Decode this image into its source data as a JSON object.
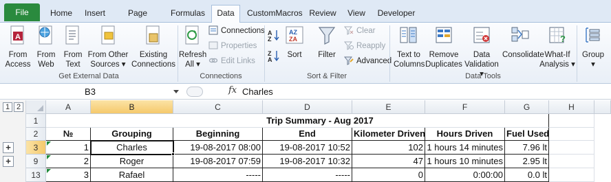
{
  "ribbon_tabs": [
    {
      "label": "File"
    },
    {
      "label": "Home"
    },
    {
      "label": "Insert"
    },
    {
      "label": "Page Layout"
    },
    {
      "label": "Formulas"
    },
    {
      "label": "Data"
    },
    {
      "label": "CustomMacros"
    },
    {
      "label": "Review"
    },
    {
      "label": "View"
    },
    {
      "label": "Developer"
    }
  ],
  "groups": {
    "external": {
      "label": "Get External Data",
      "from_access": "From\nAccess",
      "from_web": "From\nWeb",
      "from_text": "From\nText",
      "from_other": "From Other\nSources ▾",
      "existing": "Existing\nConnections"
    },
    "connections": {
      "label": "Connections",
      "refresh_all": "Refresh\nAll ▾",
      "connections": "Connections",
      "properties": "Properties",
      "edit_links": "Edit Links"
    },
    "sort": {
      "label": "Sort & Filter",
      "sort": "Sort",
      "filter": "Filter",
      "clear": "Clear",
      "reapply": "Reapply",
      "advanced": "Advanced",
      "az": "A↓Z",
      "za": "Z↓A"
    },
    "tools": {
      "label": "Data Tools",
      "text_to_columns": "Text to\nColumns",
      "remove_duplicates": "Remove\nDuplicates",
      "data_validation": "Data\nValidation ▾",
      "consolidate": "Consolidate",
      "what_if": "What-If\nAnalysis ▾"
    },
    "outline": {
      "group": "Group\n▾"
    }
  },
  "formula_bar": {
    "name_box": "B3",
    "fx": "fx",
    "value": "Charles"
  },
  "outline_levels": [
    "1",
    "2"
  ],
  "columns": [
    "A",
    "B",
    "C",
    "D",
    "E",
    "F",
    "G",
    "H"
  ],
  "row_numbers": [
    "1",
    "2",
    "3",
    "9",
    "13"
  ],
  "sheet": {
    "title": "Trip Summary - Aug 2017",
    "headers": [
      "№",
      "Grouping",
      "Beginning",
      "End",
      "Kilometer Driven",
      "Hours Driven",
      "Fuel Used"
    ],
    "rows": [
      [
        "1",
        "Charles",
        "19-08-2017 08:00",
        "19-08-2017 10:52",
        "102",
        "1 hours 14 minutes",
        "7.96 lt"
      ],
      [
        "2",
        "Roger",
        "19-08-2017 07:59",
        "19-08-2017 10:32",
        "47",
        "1 hours 10 minutes",
        "2.95 lt"
      ],
      [
        "3",
        "Rafael",
        "-----",
        "-----",
        "0",
        "0:00:00",
        "0.0 lt"
      ]
    ]
  },
  "colors": {
    "file_tab": "#2a8a3e",
    "selection": "#f5c96b"
  }
}
